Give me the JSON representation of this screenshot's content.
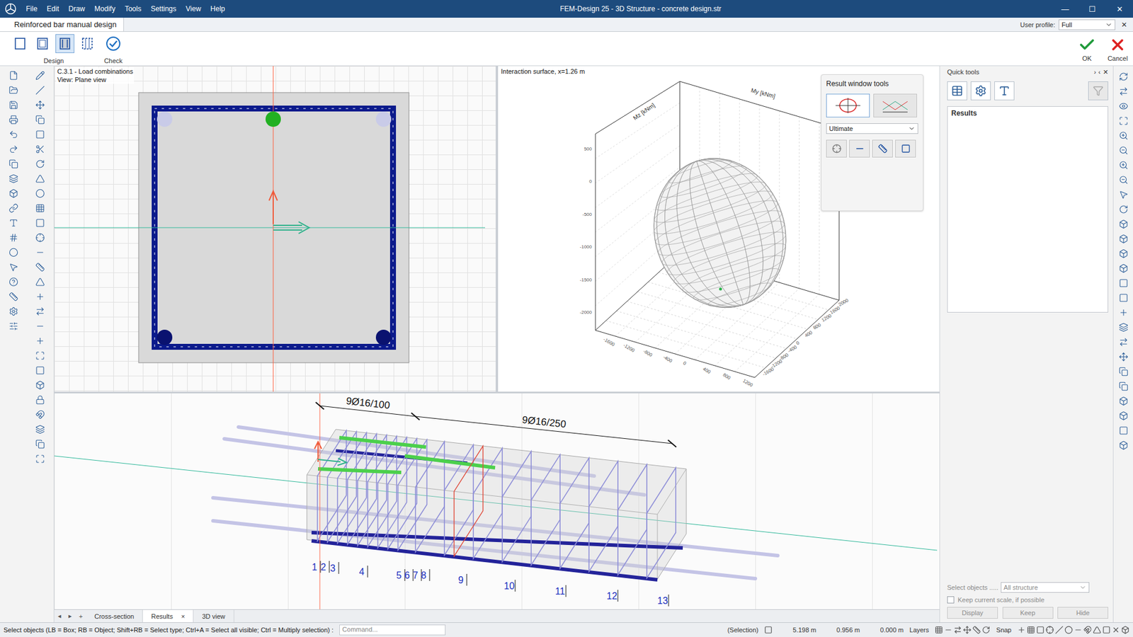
{
  "window": {
    "title": "FEM-Design 25 - 3D Structure - concrete design.str",
    "controls": [
      "—",
      "☐",
      "✕"
    ]
  },
  "menu": [
    "File",
    "Edit",
    "Draw",
    "Modify",
    "Tools",
    "Settings",
    "View",
    "Help"
  ],
  "module_tab": {
    "label": "Reinforced bar manual design",
    "close": "✕"
  },
  "user_profile": {
    "label": "User profile:",
    "value": "Full"
  },
  "ribbon": {
    "groups": [
      {
        "label": "Design",
        "buttons": [
          {
            "selected": false
          },
          {
            "selected": false
          },
          {
            "selected": true
          },
          {
            "selected": false
          }
        ]
      },
      {
        "label": "Check",
        "buttons": [
          {
            "selected": false
          }
        ]
      }
    ],
    "actions": [
      {
        "label": "OK",
        "kind": "ok"
      },
      {
        "label": "Cancel",
        "kind": "cancel"
      }
    ]
  },
  "cross_section": {
    "load_case": "C.3.1 - Load combinations",
    "view": "View: Plane view",
    "bars": [
      {
        "color": "#c9cbe8"
      },
      {
        "color": "#22b022"
      },
      {
        "color": "#c9cbe8"
      },
      {
        "color": "#0a1270"
      },
      {
        "color": "#0a1270"
      }
    ]
  },
  "interaction": {
    "title": "Interaction surface, x=1.26 m",
    "my_label": "My [kNm]",
    "mz_label": "Mz [kNm]",
    "vertical_ticks": [
      "-2000",
      "-1500",
      "-1000",
      "-500",
      "0",
      "500"
    ],
    "front_ticks": [
      "-1600",
      "-1200",
      "-800",
      "-400",
      "0",
      "400",
      "800",
      "1200"
    ],
    "side_ticks": [
      "-1600",
      "-1200",
      "-800",
      "-400",
      "0",
      "400",
      "800",
      "1200",
      "1600",
      "2000"
    ]
  },
  "result_tools": {
    "title": "Result window tools",
    "modes": [
      {
        "selected": true
      },
      {
        "selected": false
      }
    ],
    "limit_state": "Ultimate",
    "views": [
      {
        "selected": false
      },
      {
        "selected": false
      },
      {
        "selected": false
      },
      {
        "selected": false
      }
    ]
  },
  "reinforcement_3d": {
    "zones": [
      {
        "label": "9Ø16/100",
        "count": 9
      },
      {
        "label": "9Ø16/250",
        "count": 9
      }
    ],
    "sections": [
      "1",
      "2",
      "3",
      "4",
      "5",
      "6",
      "7",
      "8",
      "9",
      "10",
      "11",
      "12",
      "13"
    ]
  },
  "view_tabs": {
    "nav": [
      "◂",
      "▸",
      "+"
    ],
    "close": "×",
    "tabs": [
      {
        "label": "Cross-section",
        "selected": false,
        "closable": false
      },
      {
        "label": "Results",
        "selected": true,
        "closable": true
      },
      {
        "label": "3D view",
        "selected": false,
        "closable": false
      }
    ]
  },
  "quick_tools": {
    "title": "Quick tools",
    "header_glyphs": [
      "›",
      "‹",
      "✕"
    ],
    "results_label": "Results",
    "select_label": "Select objects .....",
    "select_value": "All structure",
    "select_disabled": true,
    "keep_scale": {
      "label": "Keep current scale, if possible",
      "checked": false
    },
    "buttons": [
      {
        "label": "Display",
        "disabled": true
      },
      {
        "label": "Keep",
        "disabled": true
      },
      {
        "label": "Hide",
        "disabled": true
      }
    ]
  },
  "status_bar": {
    "hint": "Select objects (LB = Box; RB = Object; Shift+RB = Select type; Ctrl+A = Select all visible; Ctrl = Multiply selection) :",
    "command_placeholder": "Command...",
    "mode": "(Selection)",
    "coords": [
      "5.198 m",
      "0.956 m",
      "0.000 m"
    ],
    "layers": "Layers",
    "snap": "Snap"
  }
}
